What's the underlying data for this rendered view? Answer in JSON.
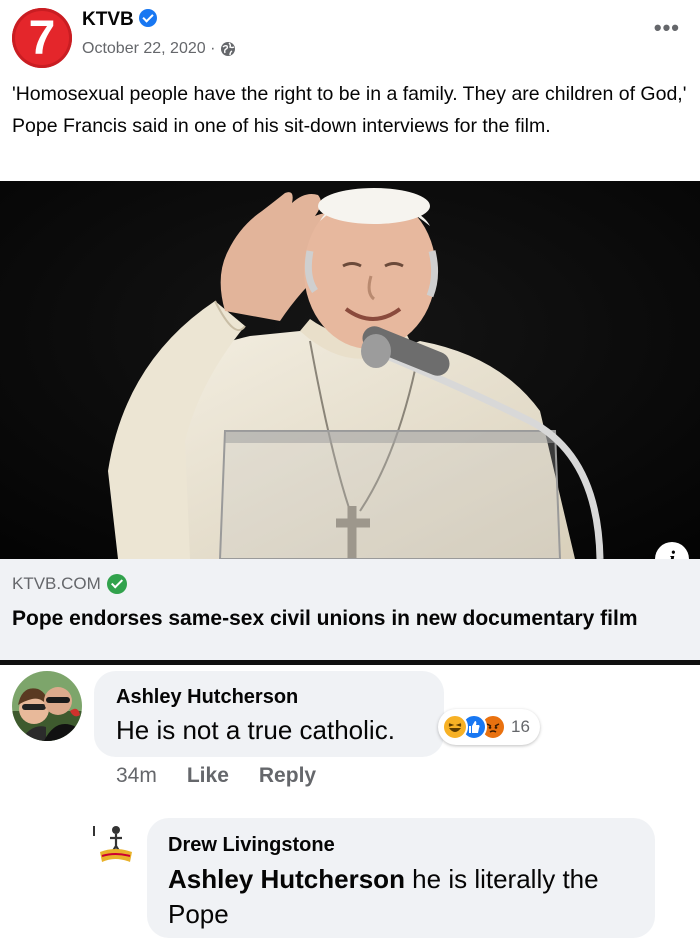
{
  "post": {
    "page_name": "KTVB",
    "avatar_glyph": "7",
    "date": "October 22, 2020 ·",
    "more_label": "•••",
    "caption": "'Homosexual people have the right to be in a family. They are children of God,' Pope Francis said in one of his sit-down interviews for the film."
  },
  "link": {
    "domain": "KTVB.COM",
    "title": "Pope endorses same-sex civil unions in new documentary film",
    "info_label": "i"
  },
  "comments": [
    {
      "author": "Ashley Hutcherson",
      "text": "He is not a true catholic.",
      "time": "34m",
      "like_label": "Like",
      "reply_label": "Reply",
      "reaction_count": "16",
      "reactions": [
        "haha-icon",
        "like-icon",
        "angry-icon"
      ]
    },
    {
      "author": "Drew Livingstone",
      "mention": "Ashley Hutcherson",
      "text": " he is literally the Pope"
    }
  ],
  "colors": {
    "brand_red": "#e4262b",
    "verified_blue": "#1877f2",
    "domain_green": "#31a24c",
    "bubble_bg": "#f0f2f5",
    "meta_gray": "#65676b"
  }
}
